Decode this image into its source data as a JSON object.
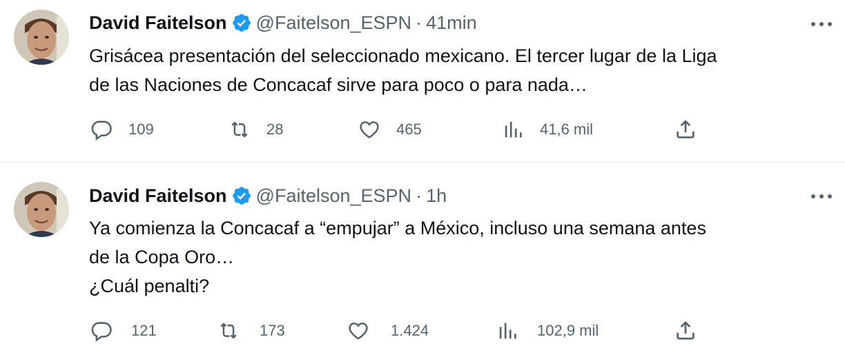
{
  "colors": {
    "text_primary": "#0f1419",
    "text_secondary": "#536471",
    "verified_blue": "#1d9bf0",
    "divider": "#eff3f4"
  },
  "icons": {
    "avatar": "profile-photo",
    "verified": "verified-badge-icon",
    "more": "more-options-icon",
    "reply": "reply-icon",
    "retweet": "retweet-icon",
    "like": "heart-icon",
    "views": "views-chart-icon",
    "share": "share-icon"
  },
  "tweets": [
    {
      "author_name": "David Faitelson",
      "handle": "@Faitelson_ESPN",
      "separator": "·",
      "time": "41min",
      "text_lines": [
        "Grisácea presentación del seleccionado mexicano. El tercer lugar de la Liga",
        "de las Naciones de Concacaf sirve para poco o para nada…"
      ],
      "replies": "109",
      "retweets": "28",
      "likes": "465",
      "views": "41,6 mil"
    },
    {
      "author_name": "David Faitelson",
      "handle": "@Faitelson_ESPN",
      "separator": "·",
      "time": "1h",
      "text_lines": [
        "Ya comienza la Concacaf a “empujar” a México, incluso una semana antes",
        "de la Copa Oro…",
        "¿Cuál penalti?"
      ],
      "replies": "121",
      "retweets": "173",
      "likes": "1.424",
      "views": "102,9 mil"
    }
  ]
}
